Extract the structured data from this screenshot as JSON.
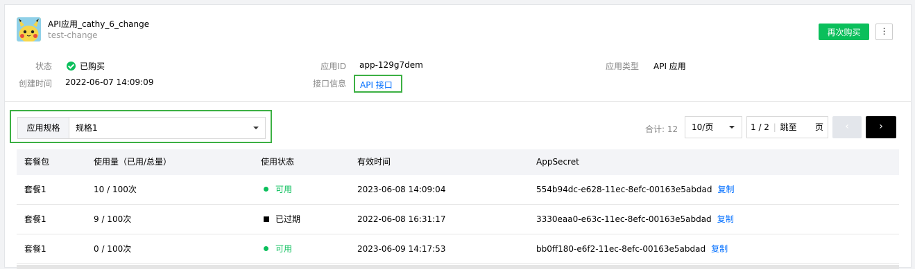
{
  "app": {
    "name": "API应用_cathy_6_change",
    "subtitle": "test-change"
  },
  "actions": {
    "buy_again": "再次购买",
    "more": "⋮"
  },
  "info": {
    "status_label": "状态",
    "status_value": "已购买",
    "created_label": "创建时间",
    "created_value": "2022-06-07 14:09:09",
    "appid_label": "应用ID",
    "appid_value": "app-129g7dem",
    "interface_label": "接口信息",
    "interface_value": "API 接口",
    "type_label": "应用类型",
    "type_value": "API 应用"
  },
  "filter": {
    "spec_label": "应用规格",
    "spec_value": "规格1"
  },
  "pagination": {
    "total": "合计: 12",
    "page_size": "10/页",
    "page_indicator": "1 / 2",
    "jump_label": "跳至",
    "page_suffix": "页",
    "prev": "‹",
    "next": "›"
  },
  "table": {
    "columns": [
      "套餐包",
      "使用量（已用/总量）",
      "使用状态",
      "有效时间",
      "AppSecret"
    ],
    "copy_label": "复制",
    "rows": [
      {
        "package": "套餐1",
        "usage": "10 / 100次",
        "status": "可用",
        "status_type": "ok",
        "valid": "2023-06-08 14:09:04",
        "secret": "554b94dc-e628-11ec-8efc-00163e5abdad"
      },
      {
        "package": "套餐1",
        "usage": "9 / 100次",
        "status": "已过期",
        "status_type": "expired",
        "valid": "2022-06-08 16:31:17",
        "secret": "3330eaa0-e63c-11ec-8efc-00163e5abdad"
      },
      {
        "package": "套餐1",
        "usage": "0 / 100次",
        "status": "可用",
        "status_type": "ok",
        "valid": "2023-06-09 14:17:53",
        "secret": "bb0ff180-e6f2-11ec-8efc-00163e5abdad"
      }
    ]
  },
  "colors": {
    "primary_green": "#0abf5b",
    "link_blue": "#006eff",
    "highlight_box": "#3cb043"
  }
}
